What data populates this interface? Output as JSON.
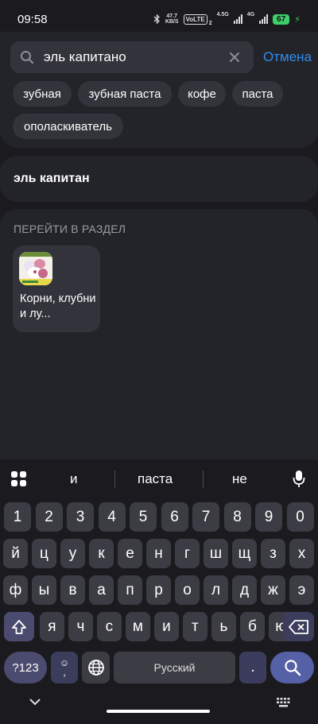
{
  "status": {
    "time": "09:58",
    "speed_value": "47.7",
    "speed_unit": "KB/S",
    "volte": "VoLTE",
    "volte_sub": "2",
    "net1": "4.5G",
    "net2": "4G",
    "battery": "67"
  },
  "search": {
    "query": "эль капитано",
    "cancel_label": "Отмена"
  },
  "chips": [
    "зубная",
    "зубная паста",
    "кофе",
    "паста",
    "ополаскиватель"
  ],
  "suggestion": "эль капитан",
  "section": {
    "title": "ПЕРЕЙТИ В РАЗДЕЛ",
    "card_label": "Корни, клубни и лу..."
  },
  "keyboard": {
    "suggestions": [
      "и",
      "паста",
      "не"
    ],
    "row_numbers": [
      "1",
      "2",
      "3",
      "4",
      "5",
      "6",
      "7",
      "8",
      "9",
      "0"
    ],
    "row1": [
      "й",
      "ц",
      "у",
      "к",
      "е",
      "н",
      "г",
      "ш",
      "щ",
      "з",
      "х"
    ],
    "row2": [
      "ф",
      "ы",
      "в",
      "а",
      "п",
      "р",
      "о",
      "л",
      "д",
      "ж",
      "э"
    ],
    "row3": [
      "я",
      "ч",
      "с",
      "м",
      "и",
      "т",
      "ь",
      "б",
      "ю"
    ],
    "sym_label": "?123",
    "emoji_comma": ",",
    "space_label": "Русский",
    "period": "."
  }
}
